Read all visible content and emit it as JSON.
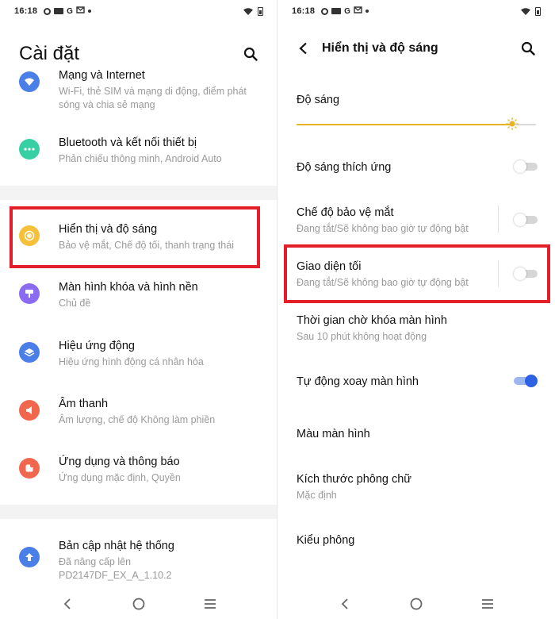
{
  "status": {
    "time": "16:18",
    "icon_letters": [
      "G"
    ]
  },
  "left": {
    "title": "Cài đặt",
    "items": [
      {
        "title": "Mạng và Internet",
        "subtitle": "Wi-Fi, thẻ SIM và mạng di động, điểm phát sóng và chia sẻ mạng",
        "icon": "wifi-icon",
        "color": "#4a7fe8"
      },
      {
        "title": "Bluetooth và kết nối thiết bị",
        "subtitle": "Phản chiếu thông minh, Android Auto",
        "icon": "more-dots-icon",
        "color": "#37d0a5"
      },
      {
        "title": "Hiển thị và độ sáng",
        "subtitle": "Bảo vệ mắt, Chế độ tối, thanh trạng thái",
        "icon": "brightness-icon",
        "color": "#f5c13b"
      },
      {
        "title": "Màn hình khóa và hình nền",
        "subtitle": "Chủ đề",
        "icon": "brush-icon",
        "color": "#8b6cf0"
      },
      {
        "title": "Hiệu ứng động",
        "subtitle": "Hiệu ứng hình động cá nhân hóa",
        "icon": "layers-icon",
        "color": "#4a7fe8"
      },
      {
        "title": "Âm thanh",
        "subtitle": "Âm lượng, chế độ Không làm phiền",
        "icon": "sound-icon",
        "color": "#f0674e"
      },
      {
        "title": "Ứng dụng và thông báo",
        "subtitle": "Ứng dụng mặc định, Quyền",
        "icon": "apps-icon",
        "color": "#f0674e"
      },
      {
        "title": "Bản cập nhật hệ thống",
        "subtitle": "Đã nâng cấp lên PD2147DF_EX_A_1.10.2",
        "icon": "update-icon",
        "color": "#4a7fe8"
      }
    ]
  },
  "right": {
    "title": "Hiển thị và độ sáng",
    "brightness_label": "Độ sáng",
    "brightness_level": 0.9,
    "items": [
      {
        "title": "Độ sáng thích ứng",
        "subtitle": "",
        "toggle": false
      },
      {
        "title": "Chế độ bảo vệ mắt",
        "subtitle": "Đang tắt/Sẽ không bao giờ tự động bật",
        "toggle": false
      },
      {
        "title": "Giao diện tối",
        "subtitle": "Đang tắt/Sẽ không bao giờ tự động bật",
        "toggle": false
      },
      {
        "title": "Thời gian chờ khóa màn hình",
        "subtitle": "Sau 10 phút không hoạt động"
      },
      {
        "title": "Tự động xoay màn hình",
        "subtitle": "",
        "toggle": true
      },
      {
        "title": "Màu màn hình",
        "subtitle": ""
      },
      {
        "title": "Kích thước phông chữ",
        "subtitle": "Mặc định"
      },
      {
        "title": "Kiểu phông",
        "subtitle": ""
      }
    ]
  },
  "colors": {
    "highlight": "#e3202a",
    "accent": "#2d63e2",
    "brightness": "#e8b425"
  }
}
